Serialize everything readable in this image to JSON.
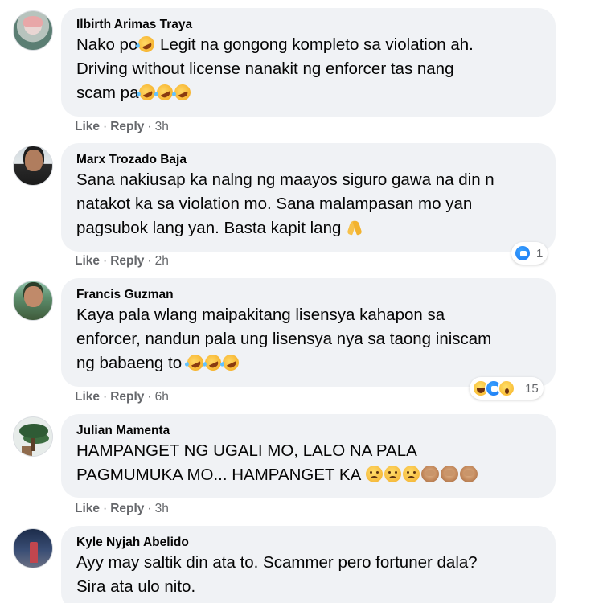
{
  "comments": [
    {
      "author": "Ilbirth Arimas Traya",
      "lines": [
        {
          "parts": [
            "Nako po",
            "",
            " Legit na gongong kompleto sa violation ah."
          ]
        },
        {
          "parts": [
            "Driving without license nanakit ng enforcer tas nang"
          ]
        },
        {
          "parts": [
            "scam pa"
          ]
        }
      ],
      "actions": {
        "like": "Like",
        "reply": "Reply",
        "time": "3h"
      }
    },
    {
      "author": "Marx Trozado Baja",
      "lines": [
        {
          "parts": [
            "Sana nakiusap ka nalng ng maayos siguro gawa na din n"
          ]
        },
        {
          "parts": [
            "natakot ka sa violation mo. Sana malampasan mo yan"
          ]
        },
        {
          "parts": [
            "pagsubok lang yan. Basta kapit lang "
          ]
        }
      ],
      "actions": {
        "like": "Like",
        "reply": "Reply",
        "time": "2h"
      },
      "reaction_count": "1"
    },
    {
      "author": "Francis Guzman",
      "lines": [
        {
          "parts": [
            "Kaya pala wlang maipakitang lisensya kahapon sa"
          ]
        },
        {
          "parts": [
            "enforcer, nandun pala ung lisensya nya sa taong iniscam"
          ]
        },
        {
          "parts": [
            "ng babaeng to "
          ]
        }
      ],
      "actions": {
        "like": "Like",
        "reply": "Reply",
        "time": "6h"
      },
      "reaction_count": "15"
    },
    {
      "author": "Julian Mamenta",
      "lines": [
        {
          "parts": [
            "HAMPANGET NG UGALI MO, LALO NA PALA"
          ]
        },
        {
          "parts": [
            "PAGMUMUKA MO... HAMPANGET KA "
          ]
        }
      ],
      "actions": {
        "like": "Like",
        "reply": "Reply",
        "time": "3h"
      }
    },
    {
      "author": "Kyle Nyjah Abelido",
      "lines": [
        {
          "parts": [
            "Ayy may saltik din ata to. Scammer pero fortuner dala?"
          ]
        },
        {
          "parts": [
            "Sira ata ulo nito."
          ]
        }
      ]
    }
  ],
  "separator": "·",
  "colors": {
    "bubble": "#f0f2f5",
    "meta": "#65676b",
    "like_blue": "#1877f2"
  },
  "icons": [
    "rofl-emoji",
    "pray-emoji",
    "sad-emoji",
    "see-no-evil-monkey-emoji",
    "like-reaction-icon",
    "haha-reaction-icon",
    "wow-reaction-icon"
  ]
}
